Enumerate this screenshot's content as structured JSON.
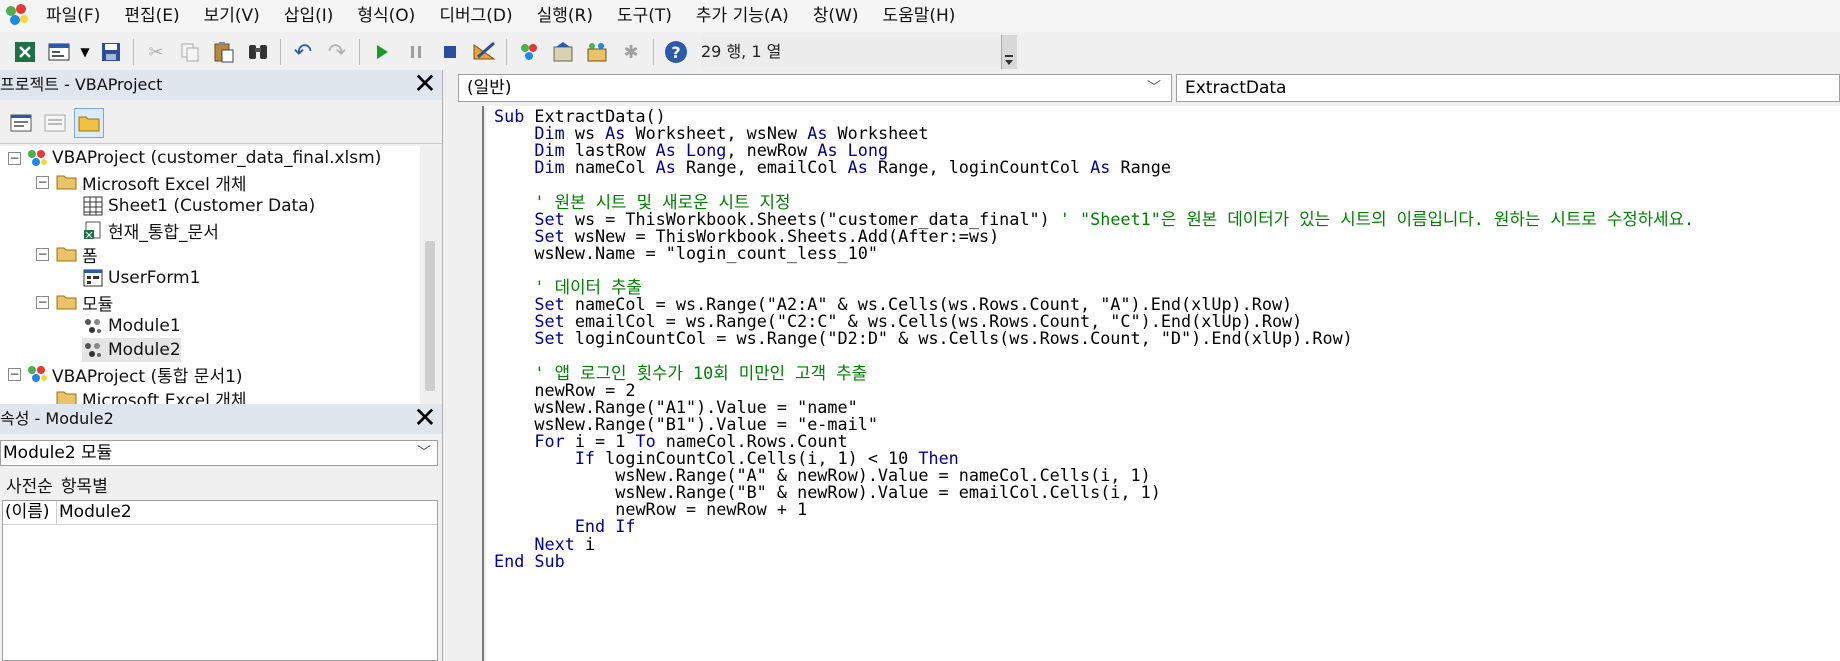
{
  "menubar": {
    "items": [
      "파일(F)",
      "편집(E)",
      "보기(V)",
      "삽입(I)",
      "형식(O)",
      "디버그(D)",
      "실행(R)",
      "도구(T)",
      "추가 기능(A)",
      "창(W)",
      "도움말(H)"
    ]
  },
  "toolbar": {
    "position_readout": "29 행, 1 열"
  },
  "project_pane": {
    "title": "프로젝트 - VBAProject",
    "tree": [
      "VBAProject (customer_data_final.xlsm)",
      "Microsoft Excel 개체",
      "Sheet1 (Customer Data)",
      "현재_통합_문서",
      "폼",
      "UserForm1",
      "모듈",
      "Module1",
      "Module2",
      "VBAProject (통합 문서1)",
      "Microsoft Excel 개체"
    ]
  },
  "props_pane": {
    "title": "속성 - Module2",
    "selected_object": "Module2 모듈",
    "tab_alpha": "사전순",
    "tab_category": "항목별",
    "prop_name": "(이름)",
    "prop_value": "Module2"
  },
  "code_pane": {
    "object_combo": "(일반)",
    "procedure_combo": "ExtractData",
    "lines": [
      [
        [
          "k",
          "Sub"
        ],
        [
          "t",
          " ExtractData()"
        ]
      ],
      [
        [
          "t",
          "    "
        ],
        [
          "k",
          "Dim"
        ],
        [
          "t",
          " ws "
        ],
        [
          "k",
          "As"
        ],
        [
          "t",
          " Worksheet, wsNew "
        ],
        [
          "k",
          "As"
        ],
        [
          "t",
          " Worksheet"
        ]
      ],
      [
        [
          "t",
          "    "
        ],
        [
          "k",
          "Dim"
        ],
        [
          "t",
          " lastRow "
        ],
        [
          "k",
          "As Long"
        ],
        [
          "t",
          ", newRow "
        ],
        [
          "k",
          "As Long"
        ]
      ],
      [
        [
          "t",
          "    "
        ],
        [
          "k",
          "Dim"
        ],
        [
          "t",
          " nameCol "
        ],
        [
          "k",
          "As"
        ],
        [
          "t",
          " Range, emailCol "
        ],
        [
          "k",
          "As"
        ],
        [
          "t",
          " Range, loginCountCol "
        ],
        [
          "k",
          "As"
        ],
        [
          "t",
          " Range"
        ]
      ],
      [],
      [
        [
          "t",
          "    "
        ],
        [
          "c",
          "' 원본 시트 및 새로운 시트 지정"
        ]
      ],
      [
        [
          "t",
          "    "
        ],
        [
          "k",
          "Set"
        ],
        [
          "t",
          " ws = ThisWorkbook.Sheets(\"customer_data_final\") "
        ],
        [
          "c",
          "' \"Sheet1\"은 원본 데이터가 있는 시트의 이름입니다. 원하는 시트로 수정하세요."
        ]
      ],
      [
        [
          "t",
          "    "
        ],
        [
          "k",
          "Set"
        ],
        [
          "t",
          " wsNew = ThisWorkbook.Sheets.Add(After:=ws)"
        ]
      ],
      [
        [
          "t",
          "    wsNew.Name = \"login_count_less_10\""
        ]
      ],
      [],
      [
        [
          "t",
          "    "
        ],
        [
          "c",
          "' 데이터 추출"
        ]
      ],
      [
        [
          "t",
          "    "
        ],
        [
          "k",
          "Set"
        ],
        [
          "t",
          " nameCol = ws.Range(\"A2:A\" & ws.Cells(ws.Rows.Count, \"A\").End(xlUp).Row)"
        ]
      ],
      [
        [
          "t",
          "    "
        ],
        [
          "k",
          "Set"
        ],
        [
          "t",
          " emailCol = ws.Range(\"C2:C\" & ws.Cells(ws.Rows.Count, \"C\").End(xlUp).Row)"
        ]
      ],
      [
        [
          "t",
          "    "
        ],
        [
          "k",
          "Set"
        ],
        [
          "t",
          " loginCountCol = ws.Range(\"D2:D\" & ws.Cells(ws.Rows.Count, \"D\").End(xlUp).Row)"
        ]
      ],
      [],
      [
        [
          "t",
          "    "
        ],
        [
          "c",
          "' 앱 로그인 횟수가 10회 미만인 고객 추출"
        ]
      ],
      [
        [
          "t",
          "    newRow = 2"
        ]
      ],
      [
        [
          "t",
          "    wsNew.Range(\"A1\").Value = \"name\""
        ]
      ],
      [
        [
          "t",
          "    wsNew.Range(\"B1\").Value = \"e-mail\""
        ]
      ],
      [
        [
          "t",
          "    "
        ],
        [
          "k",
          "For"
        ],
        [
          "t",
          " i = 1 "
        ],
        [
          "k",
          "To"
        ],
        [
          "t",
          " nameCol.Rows.Count"
        ]
      ],
      [
        [
          "t",
          "        "
        ],
        [
          "k",
          "If"
        ],
        [
          "t",
          " loginCountCol.Cells(i, 1) < 10 "
        ],
        [
          "k",
          "Then"
        ]
      ],
      [
        [
          "t",
          "            wsNew.Range(\"A\" & newRow).Value = nameCol.Cells(i, 1)"
        ]
      ],
      [
        [
          "t",
          "            wsNew.Range(\"B\" & newRow).Value = emailCol.Cells(i, 1)"
        ]
      ],
      [
        [
          "t",
          "            newRow = newRow + 1"
        ]
      ],
      [
        [
          "t",
          "        "
        ],
        [
          "k",
          "End If"
        ]
      ],
      [
        [
          "t",
          "    "
        ],
        [
          "k",
          "Next"
        ],
        [
          "t",
          " i"
        ]
      ],
      [
        [
          "k",
          "End Sub"
        ]
      ]
    ]
  },
  "colors": {
    "keyword": "#00008b",
    "comment": "#008000"
  }
}
